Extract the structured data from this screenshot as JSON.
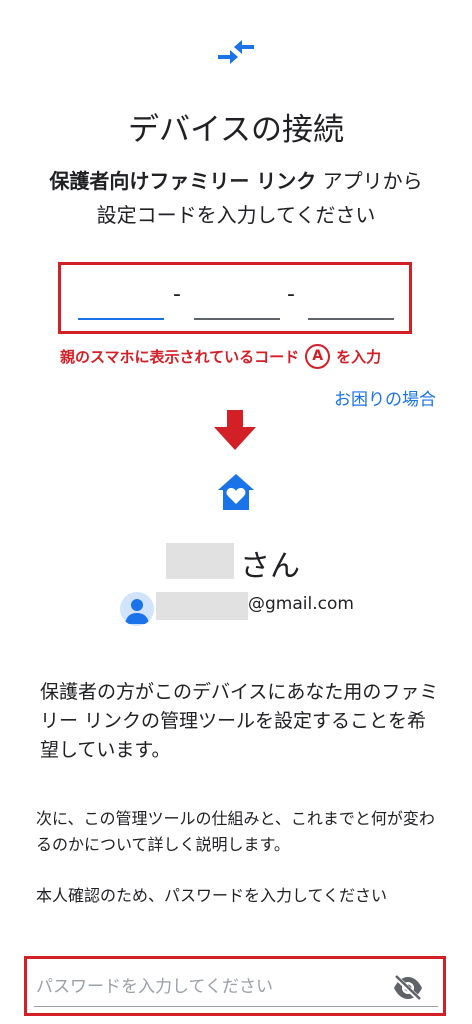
{
  "header": {
    "title": "デバイスの接続",
    "subtitle_bold": "保護者向けファミリー リンク",
    "subtitle_rest1": " アプリから",
    "subtitle_line2": "設定コードを入力してください"
  },
  "code": {
    "separator": "-",
    "note_before": "親のスマホに表示されているコード",
    "note_circle": "A",
    "note_after": "を入力"
  },
  "help_link": "お困りの場合",
  "parent": {
    "name_suffix": "さん",
    "email_domain": "@gmail.com"
  },
  "body": {
    "paragraph1": "保護者の方がこのデバイスにあなた用のファミリー リンクの管理ツールを設定することを希望しています。",
    "paragraph2": "次に、この管理ツールの仕組みと、これまでと何が変わるのかについて詳しく説明します。",
    "paragraph3": "本人確認のため、パスワードを入力してください"
  },
  "password": {
    "placeholder": "パスワードを入力してください",
    "value": ""
  },
  "colors": {
    "accent": "#1a73e8",
    "annotation_red": "#d32027"
  }
}
